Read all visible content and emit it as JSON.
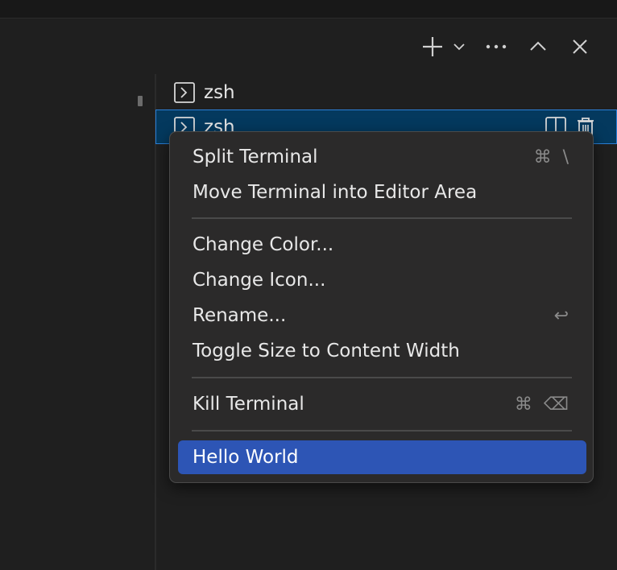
{
  "toolbar": {
    "new_terminal_icon": "plus-icon",
    "dropdown_icon": "chevron-down-icon",
    "more_icon": "ellipsis-icon",
    "maximize_icon": "chevron-up-icon",
    "close_icon": "close-icon"
  },
  "terminal_tabs": [
    {
      "label": "zsh",
      "icon": "terminal-icon",
      "selected": false
    },
    {
      "label": "zsh",
      "icon": "terminal-icon",
      "selected": true
    }
  ],
  "tab_actions": {
    "split_icon": "split-editor-icon",
    "trash_icon": "trash-icon"
  },
  "context_menu": {
    "items": [
      {
        "label": "Split Terminal",
        "shortcut_key": "\\",
        "shortcut_modifier": "⌘"
      },
      {
        "label": "Move Terminal into Editor Area"
      },
      {
        "label": "Change Color..."
      },
      {
        "label": "Change Icon..."
      },
      {
        "label": "Rename...",
        "shortcut_key": "↩"
      },
      {
        "label": "Toggle Size to Content Width"
      },
      {
        "label": "Kill Terminal",
        "shortcut_modifier": "⌘",
        "shortcut_key": "⌫"
      },
      {
        "label": "Hello World",
        "highlighted": true
      }
    ]
  },
  "colors": {
    "background": "#1f1f1f",
    "selection_background": "#04395e",
    "selection_border": "#2b7fd6",
    "menu_background": "#2b2a2a",
    "menu_highlight": "#2d55b5"
  }
}
